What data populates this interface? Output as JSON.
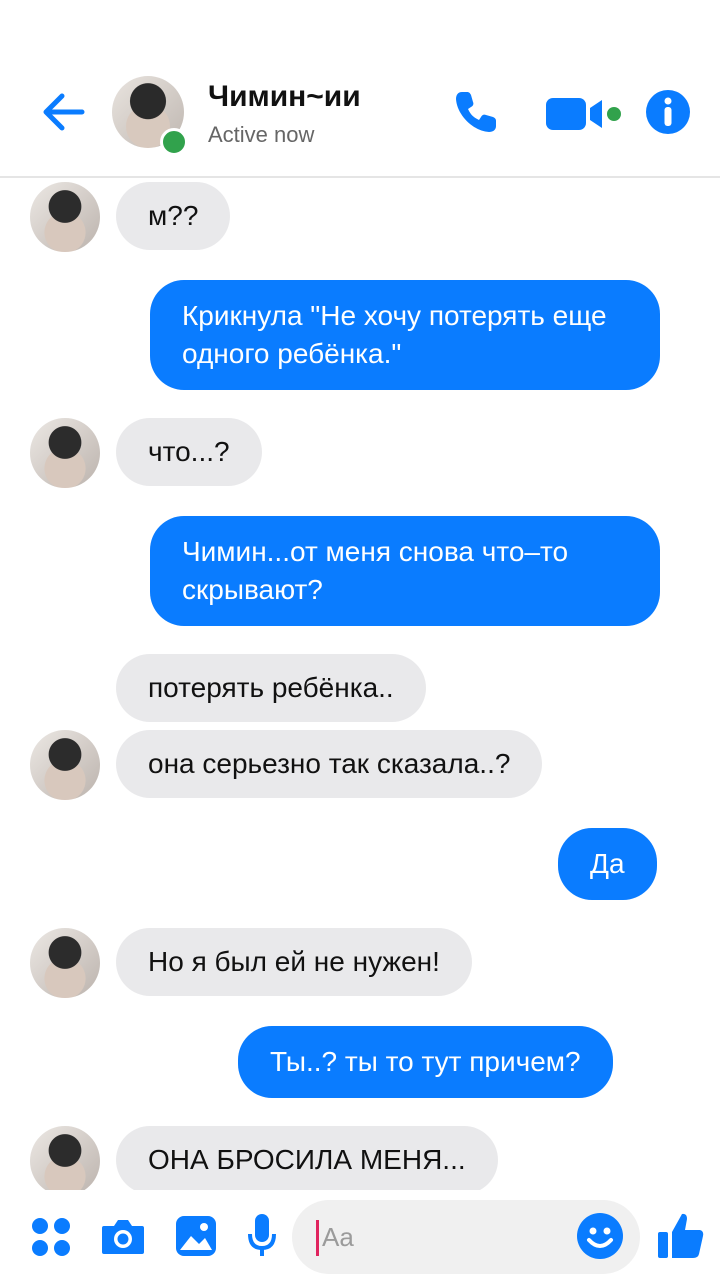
{
  "header": {
    "contact_name": "Чимин~ии",
    "status": "Active now",
    "icons": {
      "back": "back-arrow-icon",
      "phone": "phone-icon",
      "video": "video-camera-icon",
      "info": "info-icon"
    }
  },
  "messages": [
    {
      "direction": "in",
      "text": "м??"
    },
    {
      "direction": "out",
      "text": "Крикнула \"Не хочу потерять еще одного ребёнка.\""
    },
    {
      "direction": "in",
      "text": "что...?"
    },
    {
      "direction": "out",
      "text": "Чимин...от меня снова что–то скрывают?"
    },
    {
      "direction": "in",
      "text": "потерять ребёнка.."
    },
    {
      "direction": "in",
      "text": "она серьезно так сказала..?"
    },
    {
      "direction": "out",
      "text": "Да"
    },
    {
      "direction": "in",
      "text": "Но я был ей не нужен!"
    },
    {
      "direction": "out",
      "text": "Ты..? ты то тут причем?"
    },
    {
      "direction": "in",
      "text": "ОНА БРОСИЛА МЕНЯ..."
    }
  ],
  "composer": {
    "placeholder": "Aa",
    "icons": [
      "apps-grid-icon",
      "camera-icon",
      "image-icon",
      "microphone-icon",
      "emoji-icon",
      "thumbs-up-icon"
    ]
  },
  "colors": {
    "accent": "#0a7cff",
    "incoming_bubble": "#e9e9eb",
    "online": "#31a24c"
  }
}
